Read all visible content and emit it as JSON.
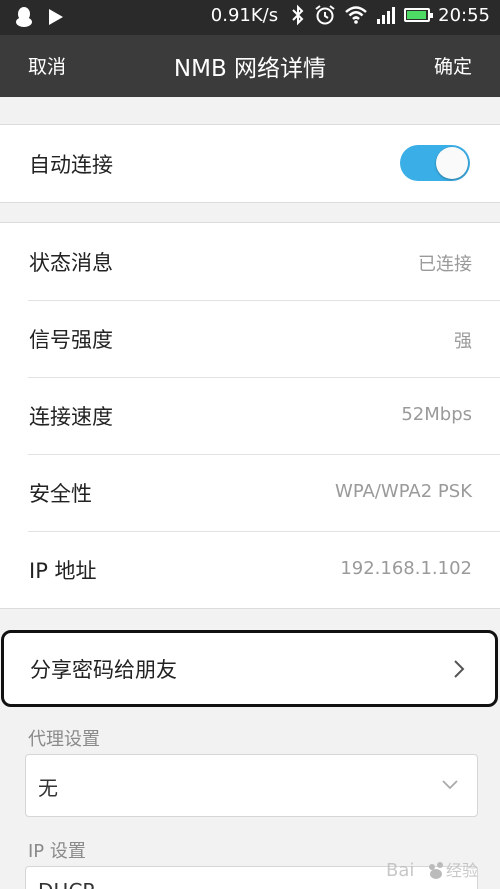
{
  "status_bar": {
    "network_speed": "0.91K/s",
    "time": "20:55",
    "battery_level": 0.85,
    "icons": [
      "qq-icon",
      "play-icon",
      "bluetooth-icon",
      "alarm-icon",
      "wifi-icon",
      "signal-icon",
      "battery-icon"
    ]
  },
  "header": {
    "cancel_label": "取消",
    "title": "NMB 网络详情",
    "confirm_label": "确定"
  },
  "auto_connect": {
    "label": "自动连接",
    "enabled": true
  },
  "details": [
    {
      "label": "状态消息",
      "value": "已连接"
    },
    {
      "label": "信号强度",
      "value": "强"
    },
    {
      "label": "连接速度",
      "value": "52Mbps"
    },
    {
      "label": "安全性",
      "value": "WPA/WPA2 PSK"
    },
    {
      "label": "IP 地址",
      "value": "192.168.1.102"
    }
  ],
  "share": {
    "label": "分享密码给朋友"
  },
  "proxy": {
    "section_label": "代理设置",
    "selected": "无"
  },
  "ip_settings": {
    "section_label": "IP 设置",
    "selected": "DHCP"
  },
  "colors": {
    "nav_bg": "#3b3b3b",
    "status_bg": "#2a2a2a",
    "toggle_on": "#3aaee6",
    "page_bg": "#f2f2f2"
  }
}
